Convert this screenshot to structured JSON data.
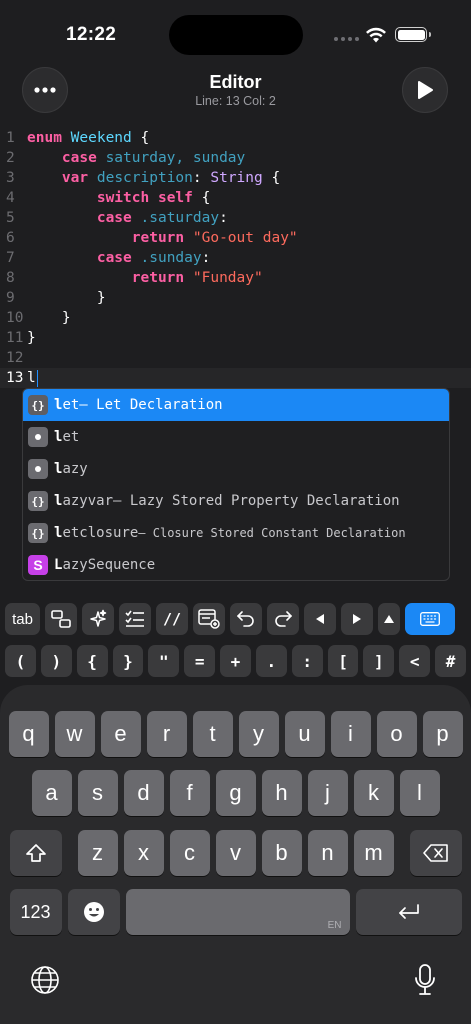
{
  "status": {
    "time": "12:22"
  },
  "header": {
    "title": "Editor",
    "position": "Line: 13 Col: 2"
  },
  "code": {
    "lines": [
      {
        "n": "1"
      },
      {
        "n": "2"
      },
      {
        "n": "3"
      },
      {
        "n": "4"
      },
      {
        "n": "5"
      },
      {
        "n": "6"
      },
      {
        "n": "7"
      },
      {
        "n": "8"
      },
      {
        "n": "9"
      },
      {
        "n": "10"
      },
      {
        "n": "11"
      },
      {
        "n": "12"
      },
      {
        "n": "13"
      }
    ],
    "t": {
      "enum": "enum",
      "Weekend": "Weekend",
      "brace_open": " {",
      "case": "case",
      "saturday_sunday": "saturday, sunday",
      "var": "var",
      "description": "description",
      "colon": ": ",
      "String": "String",
      "switch": "switch",
      "self": "self",
      "dot_saturday": ".saturday",
      "colon_only": ":",
      "return": "return",
      "str_goout": "\"Go-out day\"",
      "dot_sunday": ".sunday",
      "str_funday": "\"Funday\"",
      "brace_close": "}",
      "typed": "l"
    }
  },
  "autocomplete": {
    "items": [
      {
        "badge": "{}",
        "match": "l",
        "rest": "et",
        "desc": " – Let Declaration"
      },
      {
        "badge": "•",
        "match": "l",
        "rest": "et",
        "desc": ""
      },
      {
        "badge": "•",
        "match": "l",
        "rest": "azy",
        "desc": ""
      },
      {
        "badge": "{}",
        "match": "l",
        "rest": "azyvar",
        "desc": " – Lazy Stored Property Declaration"
      },
      {
        "badge": "{}",
        "match": "l",
        "rest": "etclosure",
        "desc": " – Closure Stored Constant Declaration"
      },
      {
        "badge": "S",
        "match": "L",
        "rest": "azySequence",
        "desc": ""
      }
    ]
  },
  "accessory": {
    "tab": "tab",
    "symbols": [
      "(",
      ")",
      "{",
      "}",
      "\"",
      "=",
      "+",
      ".",
      ":",
      "[",
      "]",
      "<",
      "#"
    ]
  },
  "keyboard": {
    "row1": [
      "q",
      "w",
      "e",
      "r",
      "t",
      "y",
      "u",
      "i",
      "o",
      "p"
    ],
    "row2": [
      "a",
      "s",
      "d",
      "f",
      "g",
      "h",
      "j",
      "k",
      "l"
    ],
    "row3": [
      "z",
      "x",
      "c",
      "v",
      "b",
      "n",
      "m"
    ],
    "numbers": "123",
    "lang": "EN"
  },
  "colors": {
    "accent": "#1b88f5",
    "keyword": "#fc5fa3",
    "type": "#5dd8ff",
    "string": "#fc6a5d",
    "class": "#d0a8ff"
  }
}
